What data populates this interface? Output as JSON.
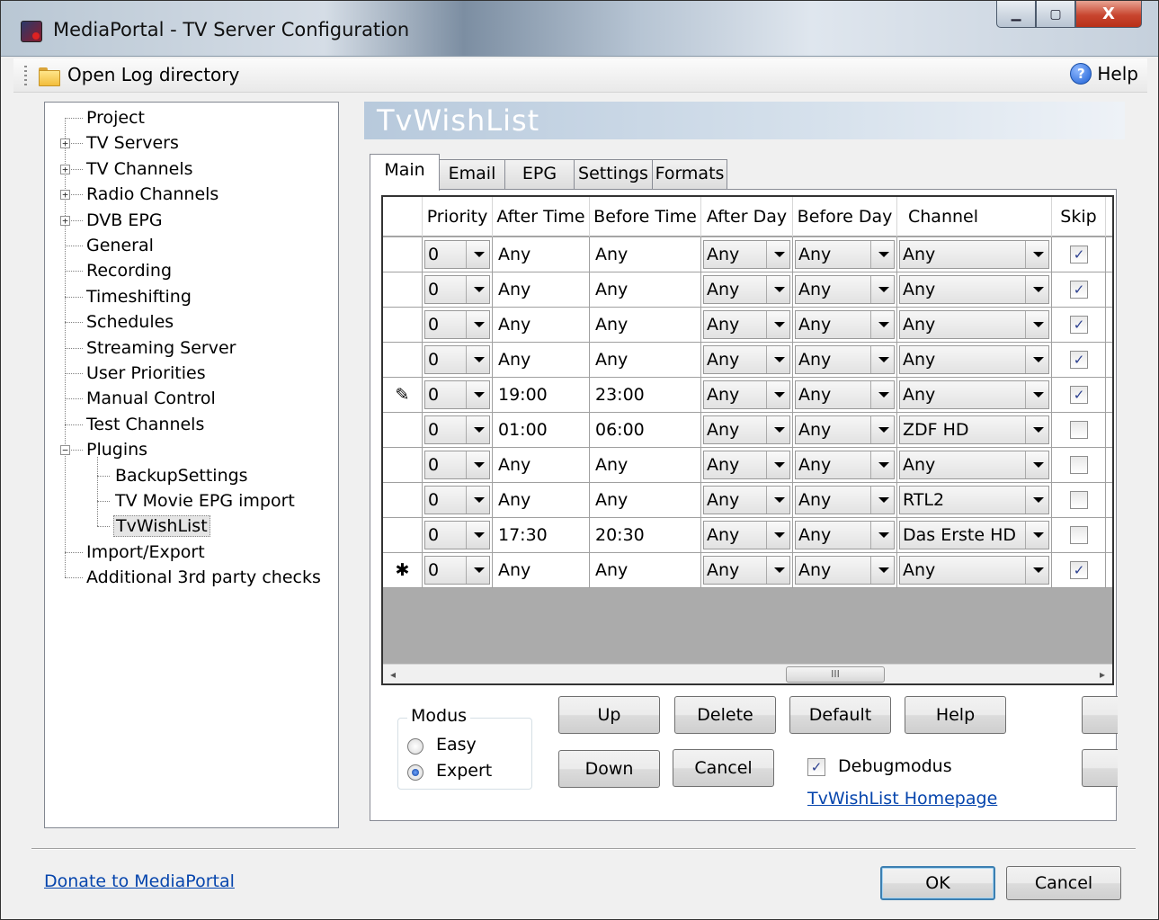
{
  "window": {
    "title": "MediaPortal - TV Server Configuration",
    "minimize": "▁",
    "maximize": "▢",
    "close": "X"
  },
  "toolbar": {
    "open_log": "Open Log directory",
    "help_glyph": "?",
    "help": "Help"
  },
  "tree": {
    "expand_glyph": "+",
    "collapse_glyph": "−",
    "items": [
      {
        "label": "Project"
      },
      {
        "label": "TV Servers"
      },
      {
        "label": "TV Channels"
      },
      {
        "label": "Radio Channels"
      },
      {
        "label": "DVB EPG"
      },
      {
        "label": "General"
      },
      {
        "label": "Recording"
      },
      {
        "label": "Timeshifting"
      },
      {
        "label": "Schedules"
      },
      {
        "label": "Streaming Server"
      },
      {
        "label": "User Priorities"
      },
      {
        "label": "Manual Control"
      },
      {
        "label": "Test Channels"
      },
      {
        "label": "Plugins"
      },
      {
        "label": "BackupSettings"
      },
      {
        "label": "TV Movie EPG import"
      },
      {
        "label": "TvWishList"
      },
      {
        "label": "Import/Export"
      },
      {
        "label": "Additional 3rd party checks"
      }
    ]
  },
  "page": {
    "title": "TvWishList"
  },
  "tabs": [
    "Main",
    "Email",
    "EPG",
    "Settings",
    "Formats"
  ],
  "grid": {
    "columns": [
      "Priority",
      "After Time",
      "Before Time",
      "After Day",
      "Before Day",
      "Channel",
      "Skip"
    ],
    "edit_marker": "✎",
    "new_marker": "✱",
    "check_glyph": "✓",
    "rows": [
      {
        "priority": "0",
        "after_time": "Any",
        "before_time": "Any",
        "after_day": "Any",
        "before_day": "Any",
        "channel": "Any",
        "skip": true
      },
      {
        "priority": "0",
        "after_time": "Any",
        "before_time": "Any",
        "after_day": "Any",
        "before_day": "Any",
        "channel": "Any",
        "skip": true
      },
      {
        "priority": "0",
        "after_time": "Any",
        "before_time": "Any",
        "after_day": "Any",
        "before_day": "Any",
        "channel": "Any",
        "skip": true
      },
      {
        "priority": "0",
        "after_time": "Any",
        "before_time": "Any",
        "after_day": "Any",
        "before_day": "Any",
        "channel": "Any",
        "skip": true
      },
      {
        "priority": "0",
        "after_time": "19:00",
        "before_time": "23:00",
        "after_day": "Any",
        "before_day": "Any",
        "channel": "Any",
        "skip": true
      },
      {
        "priority": "0",
        "after_time": "01:00",
        "before_time": "06:00",
        "after_day": "Any",
        "before_day": "Any",
        "channel": "ZDF HD",
        "skip": false
      },
      {
        "priority": "0",
        "after_time": "Any",
        "before_time": "Any",
        "after_day": "Any",
        "before_day": "Any",
        "channel": "Any",
        "skip": false
      },
      {
        "priority": "0",
        "after_time": "Any",
        "before_time": "Any",
        "after_day": "Any",
        "before_day": "Any",
        "channel": "RTL2",
        "skip": false
      },
      {
        "priority": "0",
        "after_time": "17:30",
        "before_time": "20:30",
        "after_day": "Any",
        "before_day": "Any",
        "channel": "Das Erste HD",
        "skip": false
      },
      {
        "priority": "0",
        "after_time": "Any",
        "before_time": "Any",
        "after_day": "Any",
        "before_day": "Any",
        "channel": "Any",
        "skip": true
      }
    ],
    "scroll_left": "◂",
    "scroll_right": "▸",
    "scroll_thumb": "III"
  },
  "modus": {
    "legend": "Modus",
    "easy": "Easy",
    "expert": "Expert"
  },
  "buttons": {
    "up": "Up",
    "delete": "Delete",
    "default": "Default",
    "help": "Help",
    "down": "Down",
    "cancel": "Cancel"
  },
  "debug": {
    "label": "Debugmodus",
    "checked": true,
    "homepage_link": "TvWishList Homepage"
  },
  "footer": {
    "donate": "Donate to MediaPortal",
    "ok": "OK",
    "cancel": "Cancel"
  }
}
